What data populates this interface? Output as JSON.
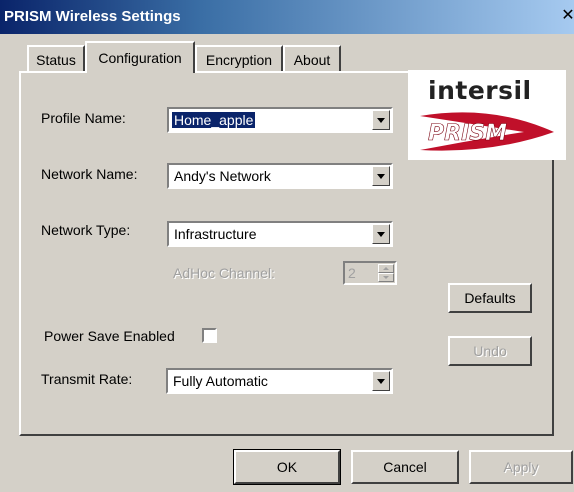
{
  "window": {
    "title": "PRISM Wireless Settings",
    "close_label": "✕"
  },
  "tabs": [
    {
      "label": "Status",
      "active": false
    },
    {
      "label": "Configuration",
      "active": true
    },
    {
      "label": "Encryption",
      "active": false
    },
    {
      "label": "About",
      "active": false
    }
  ],
  "logo": {
    "brand": "intersil",
    "product": "PRISM"
  },
  "form": {
    "profile_name": {
      "label": "Profile Name:",
      "value": "Home_apple"
    },
    "network_name": {
      "label": "Network Name:",
      "value": "Andy's Network"
    },
    "network_type": {
      "label": "Network Type:",
      "value": "Infrastructure"
    },
    "adhoc_channel": {
      "label": "AdHoc Channel:",
      "value": "2",
      "enabled": false
    },
    "power_save": {
      "label": "Power Save Enabled",
      "checked": false
    },
    "transmit_rate": {
      "label": "Transmit Rate:",
      "value": "Fully Automatic"
    }
  },
  "buttons": {
    "defaults": "Defaults",
    "undo": "Undo",
    "ok": "OK",
    "cancel": "Cancel",
    "apply": "Apply"
  },
  "colors": {
    "titlebar_start": "#0a246a",
    "titlebar_end": "#a6caf0",
    "dialog_face": "#d4d0c8",
    "selection": "#0a246a",
    "prism_red": "#c0102a"
  }
}
